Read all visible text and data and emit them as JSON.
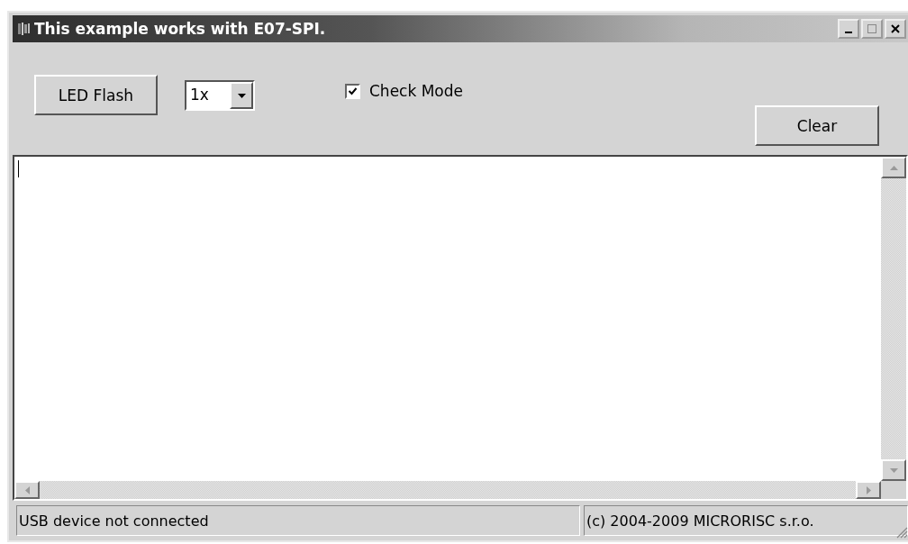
{
  "window": {
    "title": "This example works with E07-SPI."
  },
  "toolbar": {
    "flash_button": "LED Flash",
    "speed": {
      "value": "1x"
    },
    "check_mode": {
      "label": "Check Mode",
      "checked": true
    },
    "clear_button": "Clear"
  },
  "status_bar": [
    "USB device not connected",
    "(c) 2004-2009 MICRORISC s.r.o."
  ]
}
